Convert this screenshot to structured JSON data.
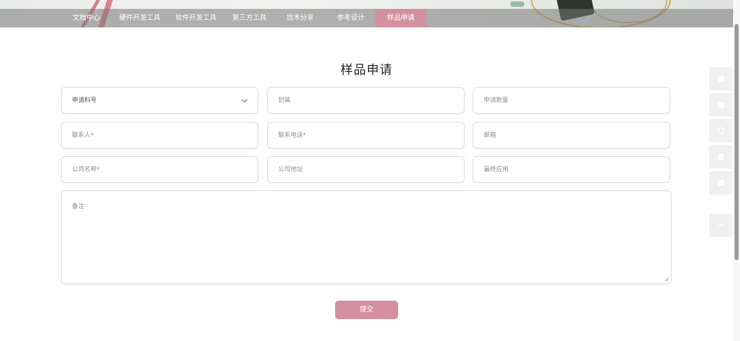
{
  "nav": {
    "items": [
      {
        "label": "文档中心"
      },
      {
        "label": "硬件开发工具"
      },
      {
        "label": "软件开发工具"
      },
      {
        "label": "第三方工具"
      },
      {
        "label": "技术分享"
      },
      {
        "label": "参考设计"
      },
      {
        "label": "样品申请"
      }
    ],
    "active_index": 6
  },
  "page": {
    "title": "样品申请"
  },
  "form": {
    "part_number": {
      "selected": "申请料号"
    },
    "package": {
      "placeholder": "封装"
    },
    "quantity": {
      "placeholder": "申请数量"
    },
    "contact": {
      "placeholder": "联系人*"
    },
    "phone": {
      "placeholder": "联系电话*"
    },
    "email": {
      "placeholder": "邮箱"
    },
    "company": {
      "placeholder": "公司名称*"
    },
    "address": {
      "placeholder": "公司地址"
    },
    "application": {
      "placeholder": "最终应用"
    },
    "remarks": {
      "placeholder": "备注"
    },
    "submit_label": "提交"
  },
  "colors": {
    "accent": "#d4909f",
    "nav_bg": "#8a8a8a"
  },
  "side_tools": [
    "chat-icon",
    "mail-icon",
    "help-icon",
    "document-icon",
    "list-icon",
    "back-to-top-icon"
  ]
}
